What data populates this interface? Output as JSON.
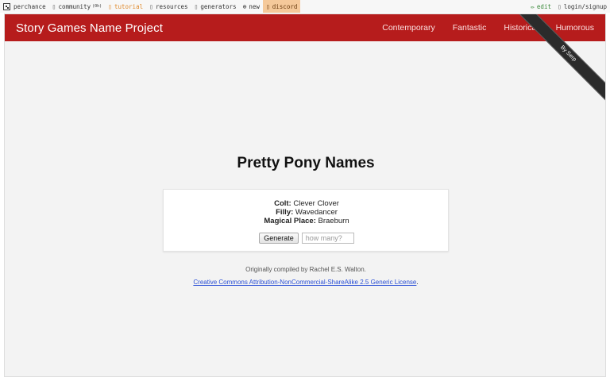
{
  "topbar": {
    "perchance": "perchance",
    "community": "community",
    "community_sub": "(0h)",
    "tutorial": "tutorial",
    "resources": "resources",
    "generators": "generators",
    "new": "new",
    "discord": "discord",
    "edit": "edit",
    "login": "login/signup"
  },
  "navbar": {
    "brand": "Story Games Name Project",
    "links": [
      "Contemporary",
      "Fantastic",
      "Historical",
      "Humorous"
    ]
  },
  "ribbon": "By Serp",
  "page": {
    "title": "Pretty Pony Names",
    "results": [
      {
        "label": "Colt:",
        "value": "Clever Clover"
      },
      {
        "label": "Filly:",
        "value": "Wavedancer"
      },
      {
        "label": "Magical Place:",
        "value": "Braeburn"
      }
    ],
    "generate_label": "Generate",
    "count_placeholder": "how many?",
    "credit": "Originally compiled by Rachel E.S. Walton.",
    "license": "Creative Commons Attribution-NonCommercial-ShareAlike 2.5 Generic License"
  },
  "colors": {
    "nav": "#b61c1c",
    "link": "#2a4fd6",
    "discord": "#f5c99a"
  }
}
